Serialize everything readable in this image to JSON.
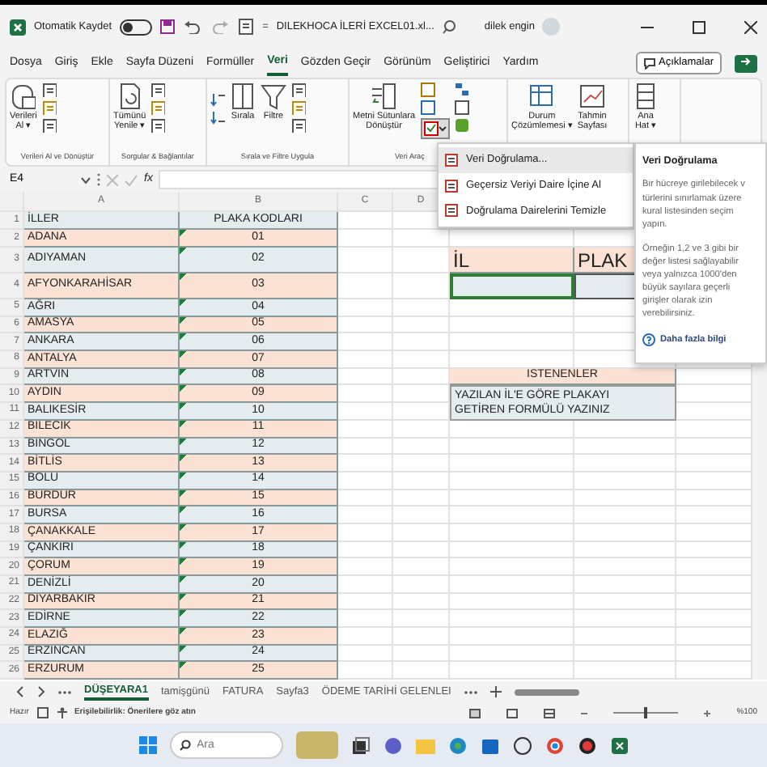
{
  "title_bar": {
    "autosave_label": "Otomatik Kaydet",
    "autosave_on": false,
    "separator": "=",
    "file_name": "DILEKHOCA İLERİ EXCEL01.xl...",
    "user": "dilek engin"
  },
  "menu_tabs": [
    {
      "label": "Dosya",
      "selected": false
    },
    {
      "label": "Giriş",
      "selected": false
    },
    {
      "label": "Ekle",
      "selected": false
    },
    {
      "label": "Sayfa Düzeni",
      "selected": false
    },
    {
      "label": "Formüller",
      "selected": false
    },
    {
      "label": "Veri",
      "selected": true
    },
    {
      "label": "Gözden Geçir",
      "selected": false
    },
    {
      "label": "Görünüm",
      "selected": false
    },
    {
      "label": "Geliştirici",
      "selected": false
    },
    {
      "label": "Yardım",
      "selected": false
    }
  ],
  "comments_button": "Açıklamalar",
  "ribbon_groups": [
    {
      "label": "Verileri Al ve Dönüştür",
      "items": [
        {
          "kind": "large",
          "label": "Verileri\nAl ▾"
        },
        {
          "kind": "smallcol"
        }
      ]
    },
    {
      "label": "Sorgular & Bağlantılar",
      "items": [
        {
          "kind": "large",
          "label": "Tümünü\nYenile ▾"
        },
        {
          "kind": "smallcol"
        }
      ]
    },
    {
      "label": "Sırala ve Filtre Uygula",
      "items": [
        {
          "kind": "sort"
        },
        {
          "kind": "large",
          "label": "Sırala"
        },
        {
          "kind": "large",
          "label": "Filtre"
        },
        {
          "kind": "smallcol"
        }
      ]
    },
    {
      "label": "Veri Araç",
      "items": [
        {
          "kind": "large",
          "label": "Metni Sütunlara\nDönüştür"
        },
        {
          "kind": "tools",
          "selected": true
        }
      ]
    },
    {
      "items": [
        {
          "kind": "large",
          "label": "Durum\nÇözümlemesi ▾"
        },
        {
          "kind": "large",
          "label": "Tahmin\nSayfası"
        }
      ]
    },
    {
      "items": [
        {
          "kind": "large",
          "label": "Ana\nHat ▾"
        }
      ]
    }
  ],
  "validation_menu": [
    {
      "label": "Veri Doğrulama...",
      "highlighted": true
    },
    {
      "label": "Geçersiz Veriyi Daire İçine Al",
      "highlighted": false
    },
    {
      "label": "Doğrulama Dairelerini Temizle",
      "highlighted": false
    }
  ],
  "tooltip": {
    "title": "Veri Doğrulama",
    "paragraphs": [
      "Bir hücreye girilebilecek v türlerini sınırlamak üzere kural listesinden seçim yapın.",
      "Örneğin 1,2 ve 3 gibi bir değer listesi sağlayabilir veya yalnızca 1000'den büyük sayılara geçerli girişler olarak izin verebilirsiniz."
    ],
    "link": "Daha fazla bilgi"
  },
  "formula_bar": {
    "name_box": "E4",
    "fx": "fx"
  },
  "sheet": {
    "column_headers": [
      "A",
      "B",
      "C",
      "D"
    ],
    "header": {
      "row": "1",
      "name": "İLLER",
      "code": "PLAKA KODLARI"
    },
    "text_number_warnings": true,
    "rows": [
      {
        "row": "2",
        "name": "ADANA",
        "code": "01"
      },
      {
        "row": "3",
        "name": "ADIYAMAN",
        "code": "02"
      },
      {
        "row": "4",
        "name": "AFYONKARAHİSAR",
        "code": "03"
      },
      {
        "row": "5",
        "name": "AĞRI",
        "code": "04"
      },
      {
        "row": "6",
        "name": "AMASYA",
        "code": "05"
      },
      {
        "row": "7",
        "name": "ANKARA",
        "code": "06"
      },
      {
        "row": "8",
        "name": "ANTALYA",
        "code": "07"
      },
      {
        "row": "9",
        "name": "ARTVİN",
        "code": "08"
      },
      {
        "row": "10",
        "name": "AYDIN",
        "code": "09"
      },
      {
        "row": "11",
        "name": "BALIKESİR",
        "code": "10"
      },
      {
        "row": "12",
        "name": "BİLECİK",
        "code": "11"
      },
      {
        "row": "13",
        "name": "BİNGÖL",
        "code": "12"
      },
      {
        "row": "14",
        "name": "BİTLİS",
        "code": "13"
      },
      {
        "row": "15",
        "name": "BOLU",
        "code": "14"
      },
      {
        "row": "16",
        "name": "BURDUR",
        "code": "15"
      },
      {
        "row": "17",
        "name": "BURSA",
        "code": "16"
      },
      {
        "row": "18",
        "name": "ÇANAKKALE",
        "code": "17"
      },
      {
        "row": "19",
        "name": "ÇANKIRI",
        "code": "18"
      },
      {
        "row": "20",
        "name": "ÇORUM",
        "code": "19"
      },
      {
        "row": "21",
        "name": "DENİZLİ",
        "code": "20"
      },
      {
        "row": "22",
        "name": "DİYARBAKIR",
        "code": "21"
      },
      {
        "row": "23",
        "name": "EDİRNE",
        "code": "22"
      },
      {
        "row": "24",
        "name": "ELAZIĞ",
        "code": "23"
      },
      {
        "row": "25",
        "name": "ERZİNCAN",
        "code": "24"
      },
      {
        "row": "26",
        "name": "ERZURUM",
        "code": "25"
      }
    ],
    "lookup_table": {
      "header_1": "İL",
      "header_2": "PLAK",
      "input_selected": true
    },
    "task_box": {
      "title": "İSTENENLER",
      "text": "YAZILAN İL'E GÖRE PLAKAYI\nGETİREN FORMÜLÜ YAZINIZ"
    }
  },
  "sheet_tabs": [
    {
      "label": "DÜŞEYARA1",
      "selected": true
    },
    {
      "label": "tamişgünü",
      "selected": false
    },
    {
      "label": "FATURA",
      "selected": false
    },
    {
      "label": "Sayfa3",
      "selected": false
    },
    {
      "label": "ÖDEME TARİHİ GELENLEI",
      "selected": false
    }
  ],
  "status_bar": {
    "ready": "Hazır",
    "accessibility": "Erişilebilirlik: Önerilere göz atın",
    "zoom_slider": {
      "level": 0.5
    },
    "zoom": "%100"
  },
  "taskbar": {
    "search_placeholder": "Ara"
  }
}
